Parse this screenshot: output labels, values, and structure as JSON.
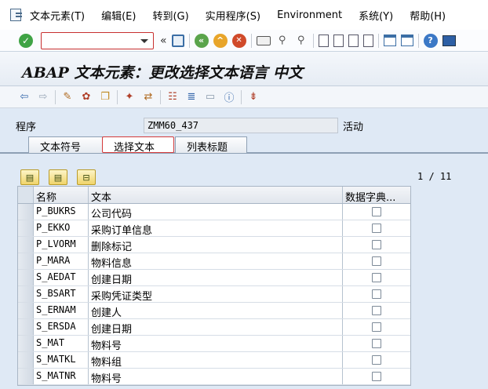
{
  "menu": [
    "文本元素(T)",
    "编辑(E)",
    "转到(G)",
    "实用程序(S)",
    "Environment",
    "系统(Y)",
    "帮助(H)"
  ],
  "toolbar": {
    "command_value": "",
    "collapse_glyph": "«"
  },
  "title": "ABAP 文本元素：更改选择文本语言 中文",
  "program": {
    "label": "程序",
    "value": "ZMM60_437",
    "status": "活动"
  },
  "tabs": [
    {
      "label": "文本符号",
      "active": false
    },
    {
      "label": "选择文本",
      "active": true
    },
    {
      "label": "列表标题",
      "active": false
    }
  ],
  "pager": "1 / 11",
  "table": {
    "columns": [
      "名称",
      "文本",
      "数据字典..."
    ],
    "rows": [
      {
        "name": "P_BUKRS",
        "text": "公司代码",
        "dict": false
      },
      {
        "name": "P_EKKO",
        "text": "采购订单信息",
        "dict": false
      },
      {
        "name": "P_LVORM",
        "text": "删除标记",
        "dict": false
      },
      {
        "name": "P_MARA",
        "text": "物料信息",
        "dict": false
      },
      {
        "name": "S_AEDAT",
        "text": "创建日期",
        "dict": false
      },
      {
        "name": "S_BSART",
        "text": "采购凭证类型",
        "dict": false
      },
      {
        "name": "S_ERNAM",
        "text": "创建人",
        "dict": false
      },
      {
        "name": "S_ERSDA",
        "text": "创建日期",
        "dict": false
      },
      {
        "name": "S_MAT",
        "text": "物料号",
        "dict": false
      },
      {
        "name": "S_MATKL",
        "text": "物料组",
        "dict": false
      },
      {
        "name": "S_MATNR",
        "text": "物料号",
        "dict": false
      }
    ]
  }
}
